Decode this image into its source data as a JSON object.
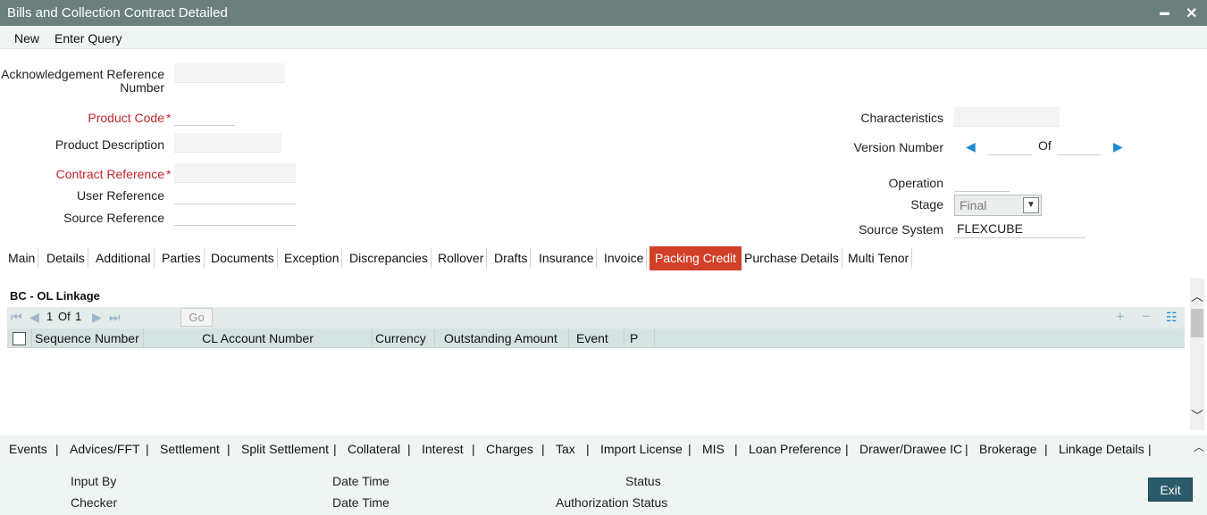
{
  "window": {
    "title": "Bills and Collection Contract Detailed",
    "minimize_glyph": "▬",
    "close_glyph": "✕"
  },
  "menu": {
    "new": "New",
    "enter_query": "Enter Query"
  },
  "form": {
    "ack_ref_label_1": "Acknowledgement Reference",
    "ack_ref_label_2": "Number",
    "ack_ref_value": "",
    "product_code_label": "Product Code",
    "product_code_value": "",
    "product_desc_label": "Product Description",
    "product_desc_value": "",
    "contract_ref_label": "Contract Reference",
    "contract_ref_value": "",
    "user_ref_label": "User Reference",
    "user_ref_value": "",
    "source_ref_label": "Source Reference",
    "source_ref_value": "",
    "required_mark": "*",
    "characteristics_label": "Characteristics",
    "characteristics_value": "",
    "version_label": "Version Number",
    "version_value": "",
    "of_label": "Of",
    "of_value": "",
    "operation_label": "Operation",
    "operation_value": "",
    "stage_label": "Stage",
    "stage_value": "Final",
    "source_system_label": "Source System",
    "source_system_value": "FLEXCUBE"
  },
  "tabs": [
    {
      "label": "Main"
    },
    {
      "label": "Details"
    },
    {
      "label": "Additional"
    },
    {
      "label": "Parties"
    },
    {
      "label": "Documents"
    },
    {
      "label": "Exception"
    },
    {
      "label": "Discrepancies"
    },
    {
      "label": "Rollover"
    },
    {
      "label": "Drafts"
    },
    {
      "label": "Insurance"
    },
    {
      "label": "Invoice"
    },
    {
      "label": "Packing Credit"
    },
    {
      "label": "Purchase Details"
    },
    {
      "label": "Multi Tenor"
    }
  ],
  "active_tab": "Packing Credit",
  "linkage": {
    "title": "BC - OL Linkage",
    "page_current": "1",
    "page_of": "Of",
    "page_total": "1",
    "go_label": "Go",
    "columns": [
      {
        "label": "Sequence Number"
      },
      {
        "label": "CL Account Number"
      },
      {
        "label": "Currency"
      },
      {
        "label": "Outstanding Amount"
      },
      {
        "label": "Event"
      },
      {
        "label": "P"
      }
    ],
    "rows": []
  },
  "bottom_links": [
    {
      "label": "Events"
    },
    {
      "label": "Advices/FFT"
    },
    {
      "label": "Settlement"
    },
    {
      "label": "Split Settlement"
    },
    {
      "label": "Collateral"
    },
    {
      "label": "Interest"
    },
    {
      "label": "Charges"
    },
    {
      "label": "Tax"
    },
    {
      "label": "Import License"
    },
    {
      "label": "MIS"
    },
    {
      "label": "Loan Preference"
    },
    {
      "label": "Drawer/Drawee IC"
    },
    {
      "label": "Brokerage"
    },
    {
      "label": "Linkage Details"
    }
  ],
  "footer": {
    "input_by": "Input By",
    "checker": "Checker",
    "date_time_1": "Date Time",
    "date_time_2": "Date Time",
    "status": "Status",
    "authorization_status": "Authorization Status",
    "exit": "Exit"
  },
  "colors": {
    "titlebar": "#6b7f7d",
    "active_tab": "#d24028",
    "required": "#c0272d",
    "exit_button": "#2b5a68",
    "nav_arrow": "#1f8bd1"
  }
}
